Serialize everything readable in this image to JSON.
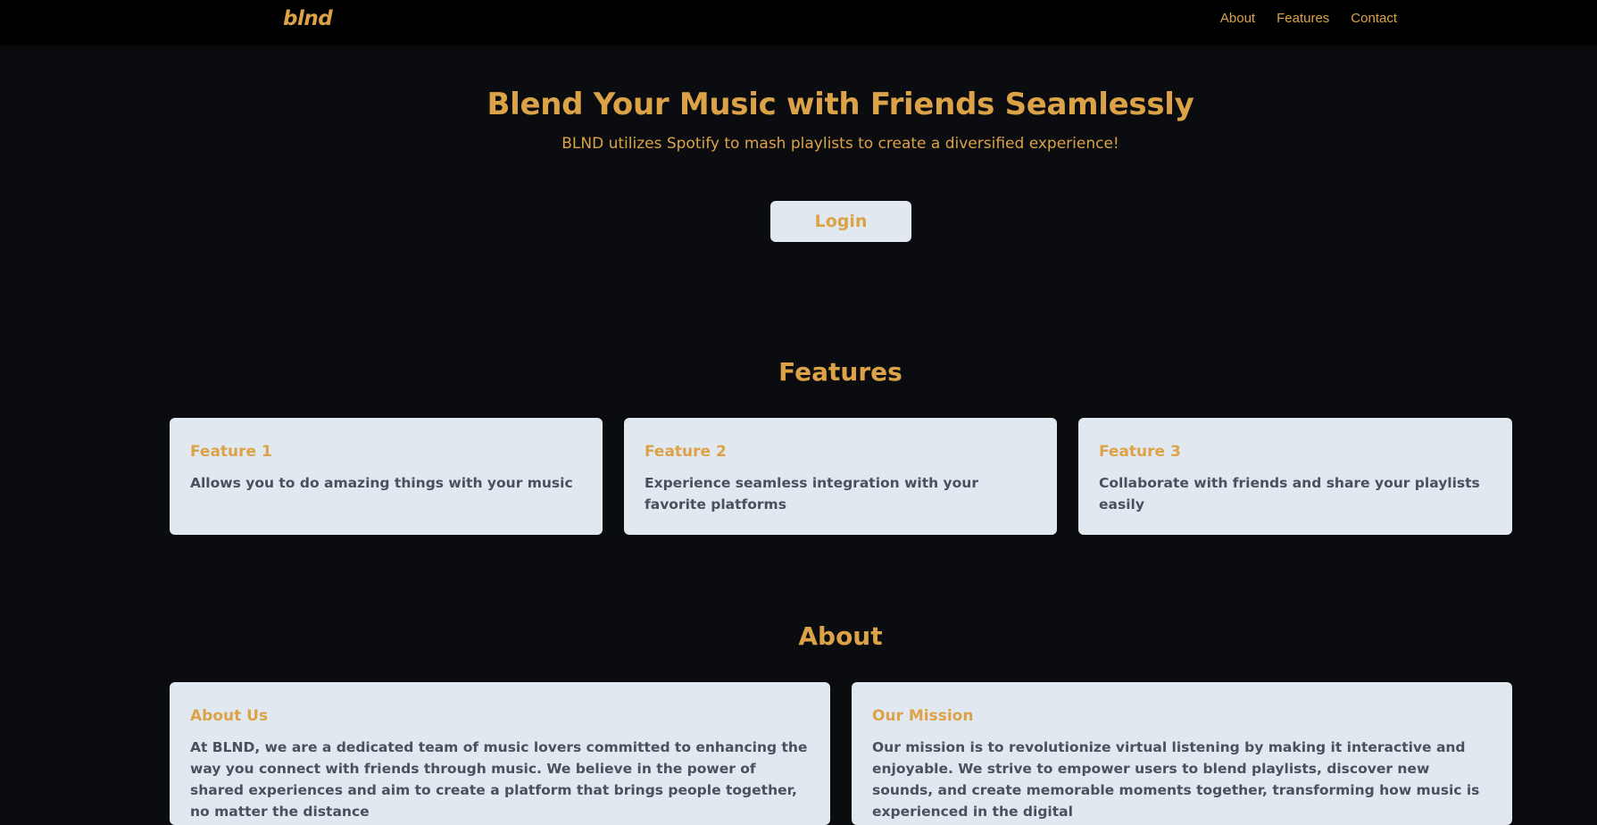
{
  "nav": {
    "logo": "blnd",
    "links": [
      "About",
      "Features",
      "Contact"
    ]
  },
  "hero": {
    "title": "Blend Your Music with Friends Seamlessly",
    "subtitle": "BLND utilizes Spotify to mash playlists to create a diversified experience!",
    "login_label": "Login"
  },
  "features": {
    "heading": "Features",
    "cards": [
      {
        "title": "Feature 1",
        "text": "Allows you to do amazing things with your music"
      },
      {
        "title": "Feature 2",
        "text": "Experience seamless integration with your favorite platforms"
      },
      {
        "title": "Feature 3",
        "text": "Collaborate with friends and share your playlists easily"
      }
    ]
  },
  "about": {
    "heading": "About",
    "cards": [
      {
        "title": "About Us",
        "text": "At BLND, we are a dedicated team of music lovers committed to enhancing the way you connect with friends through music. We believe in the power of shared experiences and aim to create a platform that brings people together, no matter the distance"
      },
      {
        "title": "Our Mission",
        "text": "Our mission is to revolutionize virtual listening by making it interactive and enjoyable. We strive to empower users to blend playlists, discover new sounds, and create memorable moments together, transforming how music is experienced in the digital"
      }
    ]
  },
  "colors": {
    "background": "#0b0c0f",
    "navbar": "#000000",
    "accent": "#dca247",
    "card": "#e2e8f0",
    "card_text": "#4a5060"
  }
}
